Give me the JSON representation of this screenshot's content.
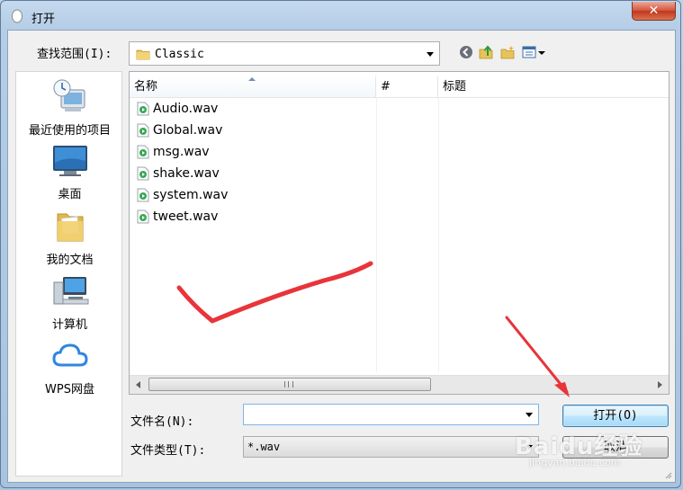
{
  "window": {
    "title": "打开",
    "close_glyph": "✕"
  },
  "lookin": {
    "label": "查找范围(I):",
    "value": "Classic"
  },
  "toolbar": {
    "icons": [
      "back-icon",
      "up-folder-icon",
      "new-folder-icon",
      "view-menu-icon"
    ]
  },
  "places": [
    {
      "label": "最近使用的项目",
      "icon": "recent-items-icon"
    },
    {
      "label": "桌面",
      "icon": "desktop-icon"
    },
    {
      "label": "我的文档",
      "icon": "documents-icon"
    },
    {
      "label": "计算机",
      "icon": "computer-icon"
    },
    {
      "label": "WPS网盘",
      "icon": "wps-cloud-icon"
    }
  ],
  "columns": {
    "name": "名称",
    "hash": "#",
    "title": "标题"
  },
  "files": [
    {
      "name": "Audio.wav"
    },
    {
      "name": "Global.wav"
    },
    {
      "name": "msg.wav"
    },
    {
      "name": "shake.wav"
    },
    {
      "name": "system.wav"
    },
    {
      "name": "tweet.wav"
    }
  ],
  "filename": {
    "label": "文件名(N):",
    "value": ""
  },
  "filetype": {
    "label": "文件类型(T):",
    "value": "*.wav"
  },
  "buttons": {
    "open": "打开(O)",
    "cancel": "取消"
  },
  "colors": {
    "annotation": "#e8343a",
    "accent": "#3c7fb1"
  },
  "watermark": {
    "text": "Baidu经验",
    "sub": "jingyan.baidu.com"
  }
}
